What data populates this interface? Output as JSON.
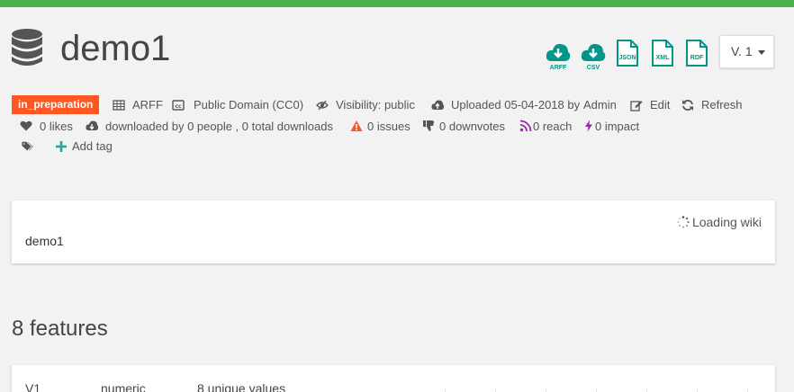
{
  "header": {
    "title": "demo1",
    "downloads": [
      {
        "label": "ARFF",
        "icon": "cloud-download-icon"
      },
      {
        "label": "CSV",
        "icon": "cloud-download-icon"
      }
    ],
    "formats": [
      {
        "label": "JSON",
        "icon": "file-icon"
      },
      {
        "label": "XML",
        "icon": "file-icon"
      },
      {
        "label": "RDF",
        "icon": "file-icon"
      }
    ],
    "version": "V. 1"
  },
  "meta": {
    "status": "in_preparation",
    "format": "ARFF",
    "license": "Public Domain (CC0)",
    "visibility": "Visibility: public",
    "uploaded": "Uploaded 05-04-2018 by",
    "uploader": "Admin",
    "edit": "Edit",
    "refresh": "Refresh",
    "likes": "0 likes",
    "downloaded": "downloaded by 0 people , 0 total downloads",
    "issues": "0 issues",
    "downvotes": "0 downvotes",
    "reach": "0 reach",
    "impact": "0 impact",
    "add_tag": "Add tag"
  },
  "wiki": {
    "loading": "Loading wiki",
    "description": "demo1"
  },
  "features": {
    "heading": "8 features",
    "rows": [
      {
        "name": "V1",
        "type": "numeric",
        "unique": "8 unique values"
      }
    ]
  },
  "colors": {
    "accent": "#26a69a",
    "brand_bar": "#4caf50",
    "status_badge": "#ff5722",
    "icon_teal": "#009688",
    "warning": "#ff5722",
    "rss": "#9c27b0",
    "impact": "#9c27b0"
  }
}
